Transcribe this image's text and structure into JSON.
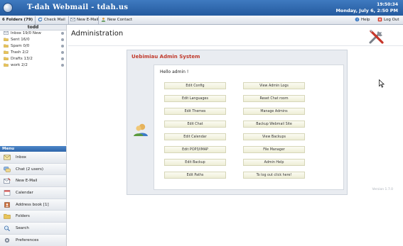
{
  "header": {
    "title": "T-dah Webmail - tdah.us",
    "time": "19:50:34",
    "date": "Monday, July 6, 2:50 PM"
  },
  "toolbar": {
    "folders_count": "6 Folders (79)",
    "check_mail": "Check Mail",
    "new_mail": "New E-Mail",
    "new_contact": "New Contact",
    "help": "Help",
    "logout": "Log Out"
  },
  "folders": {
    "user": "todd",
    "items": [
      {
        "label": "Inbox 19/0 New",
        "icon": "inbox-icon"
      },
      {
        "label": "Sent 16/0",
        "icon": "folder-icon"
      },
      {
        "label": "Spam 0/0",
        "icon": "folder-icon"
      },
      {
        "label": "Trash 2/2",
        "icon": "trash-icon"
      },
      {
        "label": "Drafts 13/2",
        "icon": "folder-icon"
      },
      {
        "label": "work 2/2",
        "icon": "folder-icon"
      }
    ]
  },
  "menu": {
    "header": "Menu",
    "items": [
      {
        "label": "Inbox",
        "icon": "envelope-icon"
      },
      {
        "label": "Chat (2 users)",
        "icon": "chat-icon"
      },
      {
        "label": "New E-Mail",
        "icon": "compose-icon"
      },
      {
        "label": "Calendar",
        "icon": "calendar-icon"
      },
      {
        "label": "Address book [1]",
        "icon": "address-book-icon"
      },
      {
        "label": "Folders",
        "icon": "folder-icon"
      },
      {
        "label": "Search",
        "icon": "search-icon"
      },
      {
        "label": "Preferences",
        "icon": "preferences-icon"
      }
    ]
  },
  "main": {
    "page_title": "Administration",
    "panel_title": "Uebimiau Admin System",
    "greeting": "Hello admin !",
    "buttons": [
      "Edit Config",
      "View Admin Logs",
      "Edit Languages",
      "Reset Chat room",
      "Edit Themes",
      "Manage Admins",
      "Edit Chat",
      "Backup Webmail Site",
      "Edit Calendar",
      "View Backups",
      "Edit POP3/IMAP",
      "File Manager",
      "Edit Backup",
      "Admin Help",
      "Edit Paths",
      "To log out click here!"
    ],
    "version": "Version 1.7.0"
  },
  "colors": {
    "header_blue": "#2f67aa",
    "panel_title_red": "#c0392b",
    "button_bg": "#f3f3df"
  }
}
